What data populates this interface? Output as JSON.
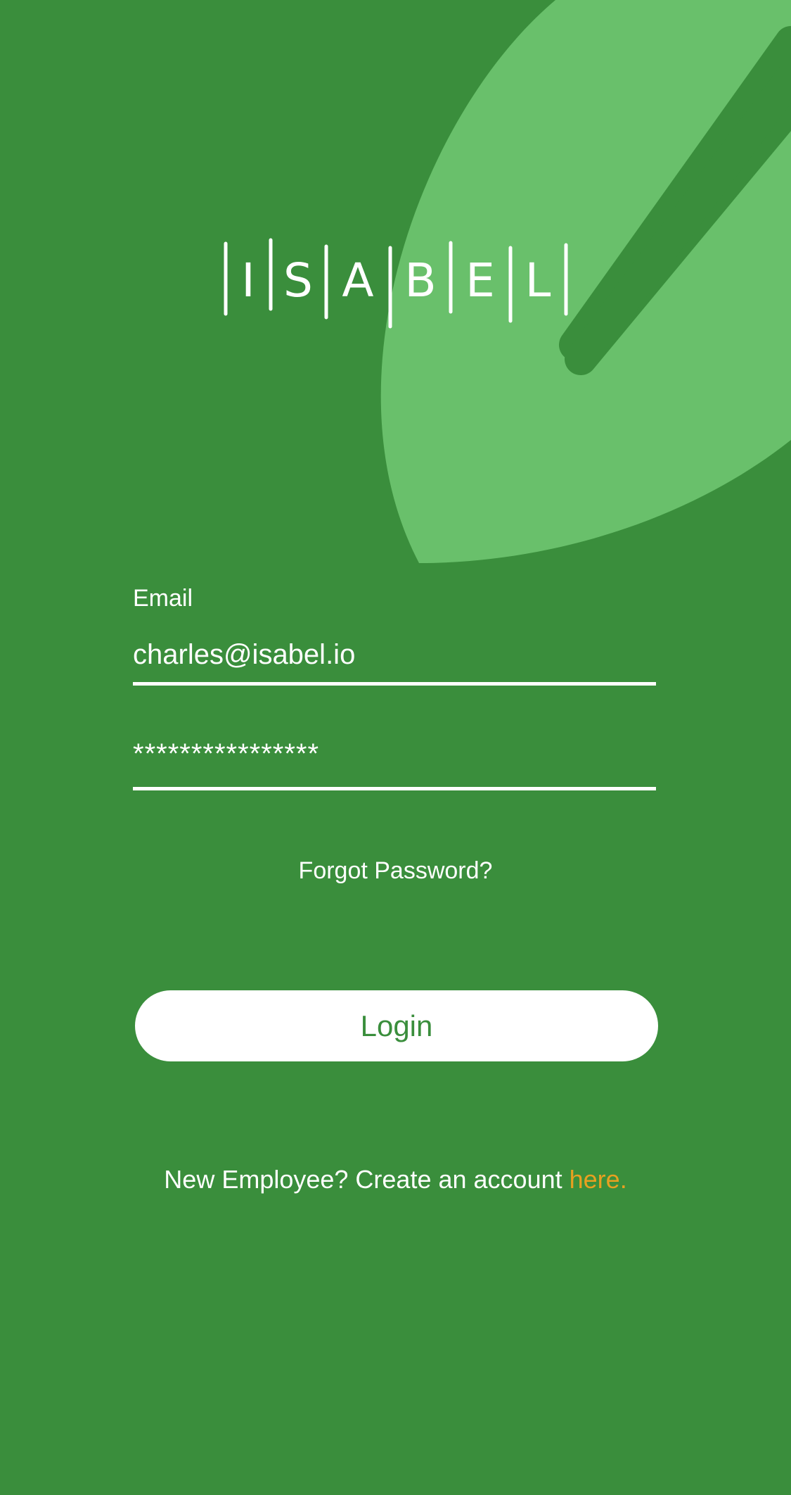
{
  "app": {
    "logo_text": "ISABEL",
    "colors": {
      "background": "#3a8e3c",
      "leaf": "#69c06b",
      "accent": "#e8a020",
      "text": "#ffffff"
    }
  },
  "form": {
    "email_label": "Email",
    "email_value": "charles@isabel.io",
    "password_value": "****************",
    "forgot_password": "Forgot Password?",
    "login_button": "Login"
  },
  "signup": {
    "prefix": "New Employee? Create an account ",
    "link": "here",
    "suffix": "."
  }
}
